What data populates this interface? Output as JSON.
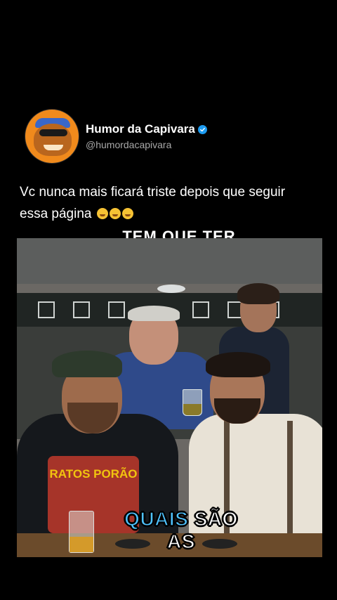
{
  "post": {
    "display_name": "Humor da Capivara",
    "handle": "@humordacapivara",
    "verified": true,
    "caption": "Vc nunca mais ficará triste depois que seguir",
    "caption_line2": "essa página",
    "caption_emoji_count": 3,
    "caption_emoji": "rolling-on-floor-laughing-emoji"
  },
  "video": {
    "overlay_top_text": "TEM QUE TER",
    "subtitle_highlight": "QUAIS",
    "subtitle_rest": "SÃO AS",
    "shirt_text": "RATOS PORÃO"
  },
  "colors": {
    "background": "#000000",
    "verified_badge": "#1d9bf0",
    "subtitle_highlight": "#4fc3ff",
    "handle_text": "#a8a8a8"
  }
}
